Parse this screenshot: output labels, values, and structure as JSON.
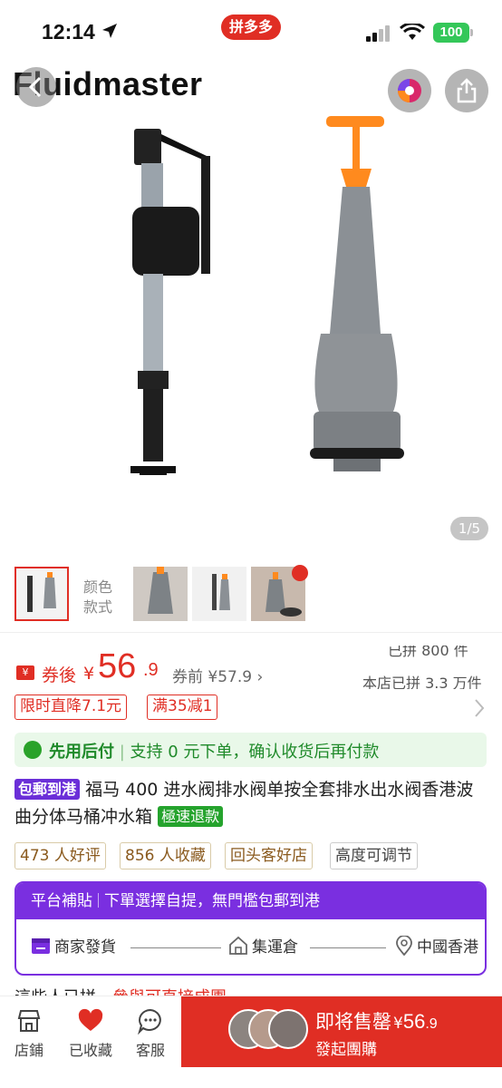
{
  "status": {
    "time": "12:14",
    "app_badge": "拼多多",
    "battery": "100"
  },
  "hero": {
    "brand": "Fluidmaster",
    "page_indicator": "1/5"
  },
  "variants": {
    "label": "颜色款式"
  },
  "price": {
    "coupon_icon": "¥",
    "coupon_label": "券後",
    "currency": "¥",
    "integer": "56",
    "decimal": ".9",
    "original": "券前 ¥57.9",
    "sold_line1": "已拼 800 件",
    "sold_line2": "本店已拼 3.3 万件"
  },
  "promos": [
    "限时直降7.1元",
    "满35减1"
  ],
  "pay_later": {
    "label": "先用后付",
    "text": "支持 0 元下单，确认收货后再付款"
  },
  "title": {
    "badge": "包郵到港",
    "text": "福马 400 进水阀排水阀单按全套排水出水阀香港波曲分体马桶冲水箱",
    "refund_badge": "極速退款"
  },
  "review_tags": [
    "473 人好评",
    "856 人收藏",
    "回头客好店",
    "高度可调节"
  ],
  "subsidy": {
    "title": "平台補貼",
    "desc": "下單選擇自提，無門檻包郵到港",
    "steps": [
      "商家發貨",
      "集運倉",
      "中國香港"
    ]
  },
  "peek": {
    "text": "這些人已拼，",
    "red": "參與可直接成團"
  },
  "bottom": {
    "nav": [
      "店鋪",
      "已收藏",
      "客服"
    ],
    "buy_main": "即将售罄",
    "buy_currency": "¥",
    "buy_int": "56",
    "buy_dec": ".9",
    "buy_sub": "發起團購"
  },
  "colors": {
    "accent": "#e02e24",
    "purple": "#7a2fe0",
    "green": "#25a32d"
  }
}
